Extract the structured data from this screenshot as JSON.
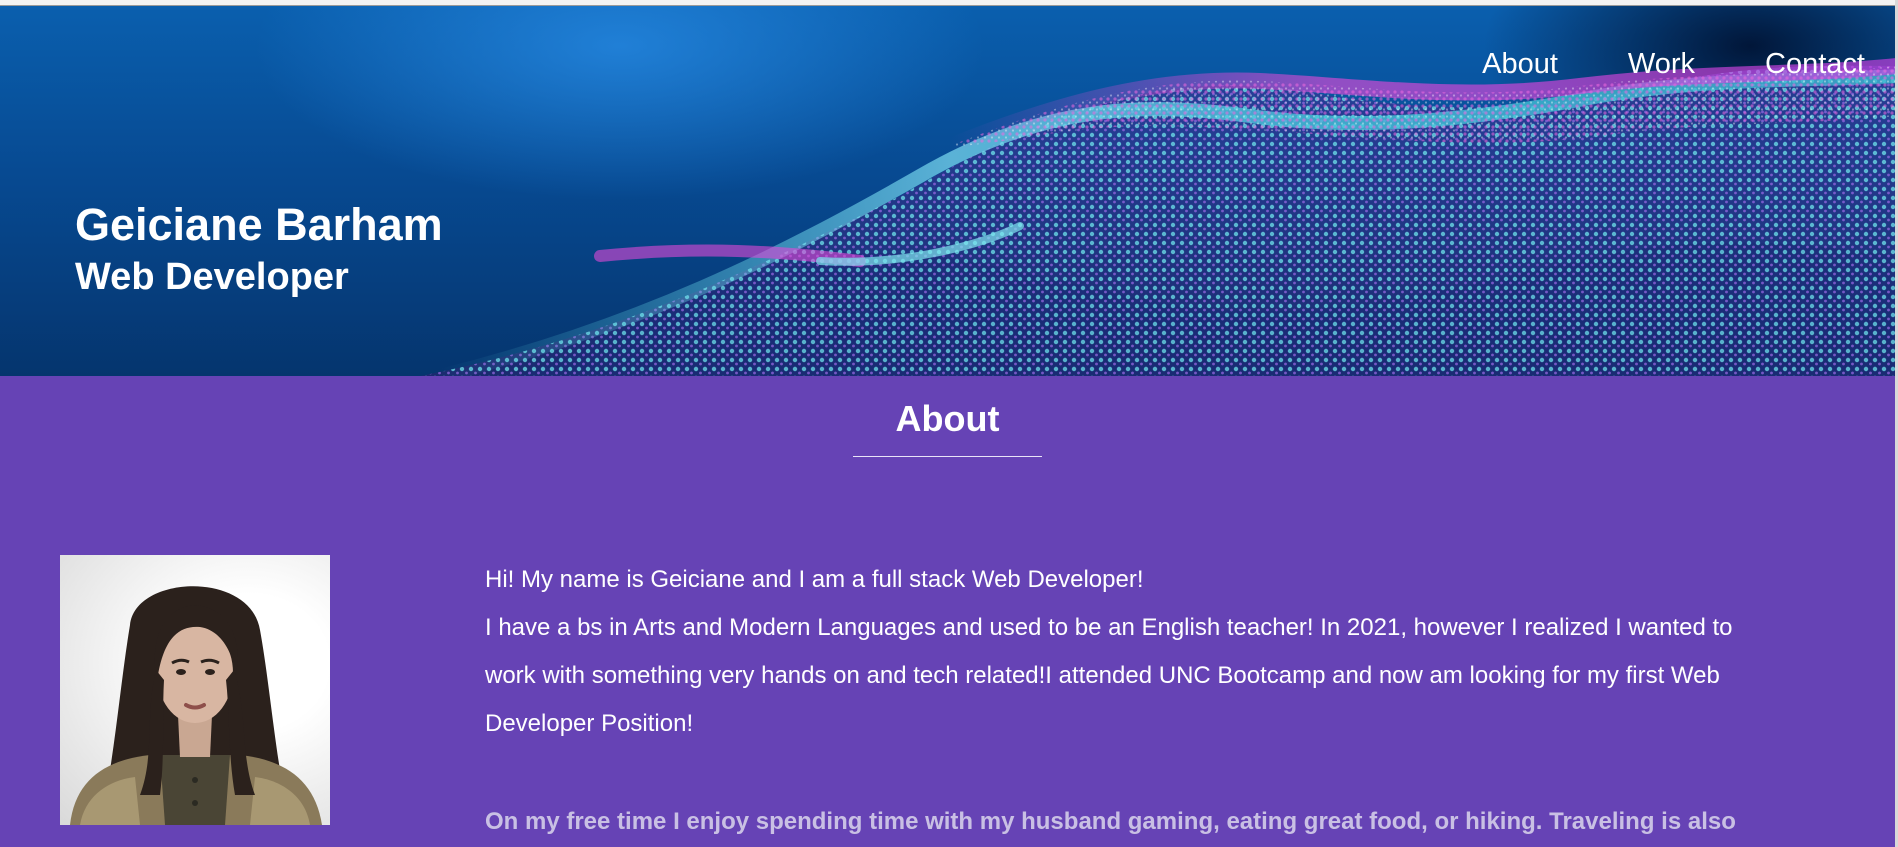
{
  "nav": {
    "items": [
      {
        "label": "About"
      },
      {
        "label": "Work"
      },
      {
        "label": "Contact"
      }
    ]
  },
  "hero": {
    "name": "Geiciane Barham",
    "role": "Web Developer"
  },
  "about": {
    "title": "About",
    "intro": "Hi! My name is Geiciane and I am a full stack Web Developer!",
    "background": "I have a bs in Arts and Modern Languages and used to be an English teacher! In 2021, however I realized I wanted to work with something very hands on and tech related!I attended UNC Bootcamp and now am looking for my first Web Developer Position!",
    "free_time": "On my free time I enjoy spending time with my husband gaming, eating great food, or hiking. Traveling is also"
  },
  "colors": {
    "about_bg": "#6643b5",
    "hero_blue": "#074a92",
    "wave_cyan": "#5ee0e8",
    "wave_magenta": "#e04ad8"
  }
}
